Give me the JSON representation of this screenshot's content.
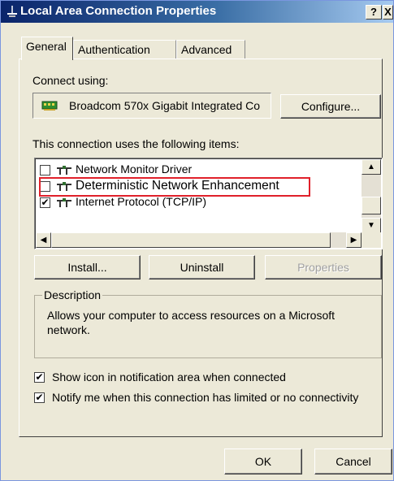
{
  "window": {
    "title": "Local Area Connection Properties",
    "help_label": "?",
    "close_label": "X"
  },
  "tabs": [
    {
      "label": "General",
      "active": true
    },
    {
      "label": "Authentication",
      "active": false
    },
    {
      "label": "Advanced",
      "active": false
    }
  ],
  "general": {
    "connect_using_label": "Connect using:",
    "adapter_name": "Broadcom 570x Gigabit Integrated Co",
    "configure_button": "Configure...",
    "items_label": "This connection uses the following items:",
    "items": [
      {
        "label": "Network Monitor Driver",
        "checked": false,
        "icon": "network-component-icon"
      },
      {
        "label": "Deterministic Network Enhancement",
        "checked": false,
        "icon": "network-component-icon",
        "highlighted": true
      },
      {
        "label": "Internet Protocol (TCP/IP)",
        "checked": true,
        "icon": "network-component-icon"
      }
    ],
    "install_button": "Install...",
    "uninstall_button": "Uninstall",
    "properties_button": "Properties",
    "description_title": "Description",
    "description_text": "Allows your computer to access resources on a Microsoft network.",
    "show_icon_label": "Show icon in notification area when connected",
    "show_icon_checked": true,
    "notify_label": "Notify me when this connection has limited or no connectivity",
    "notify_checked": true
  },
  "footer": {
    "ok_button": "OK",
    "cancel_button": "Cancel"
  },
  "colors": {
    "dialog_bg": "#ece9d8",
    "highlight_border": "#e0202a",
    "title_gradient_start": "#0a246a"
  }
}
